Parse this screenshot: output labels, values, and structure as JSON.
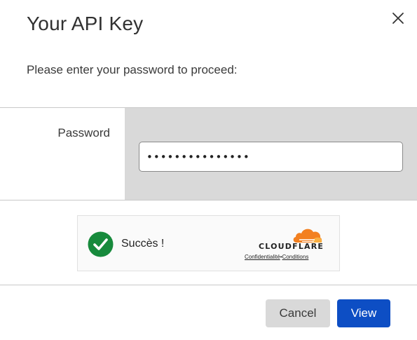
{
  "dialog": {
    "title": "Your API Key",
    "prompt": "Please enter your password to proceed:",
    "close_icon": "close-icon"
  },
  "form": {
    "password_label": "Password",
    "password_value": "•••••••••••••••"
  },
  "captcha": {
    "status_text": "Succès !",
    "status_icon": "checkmark-circle-icon",
    "status_color": "#178a3c",
    "brand_word": "CLOUDFLARE",
    "brand_color": "#f38020",
    "privacy_link": "Confidentialité",
    "separator": "•",
    "terms_link": "Conditions"
  },
  "footer": {
    "cancel_label": "Cancel",
    "view_label": "View",
    "primary_color": "#0d4ec4"
  }
}
